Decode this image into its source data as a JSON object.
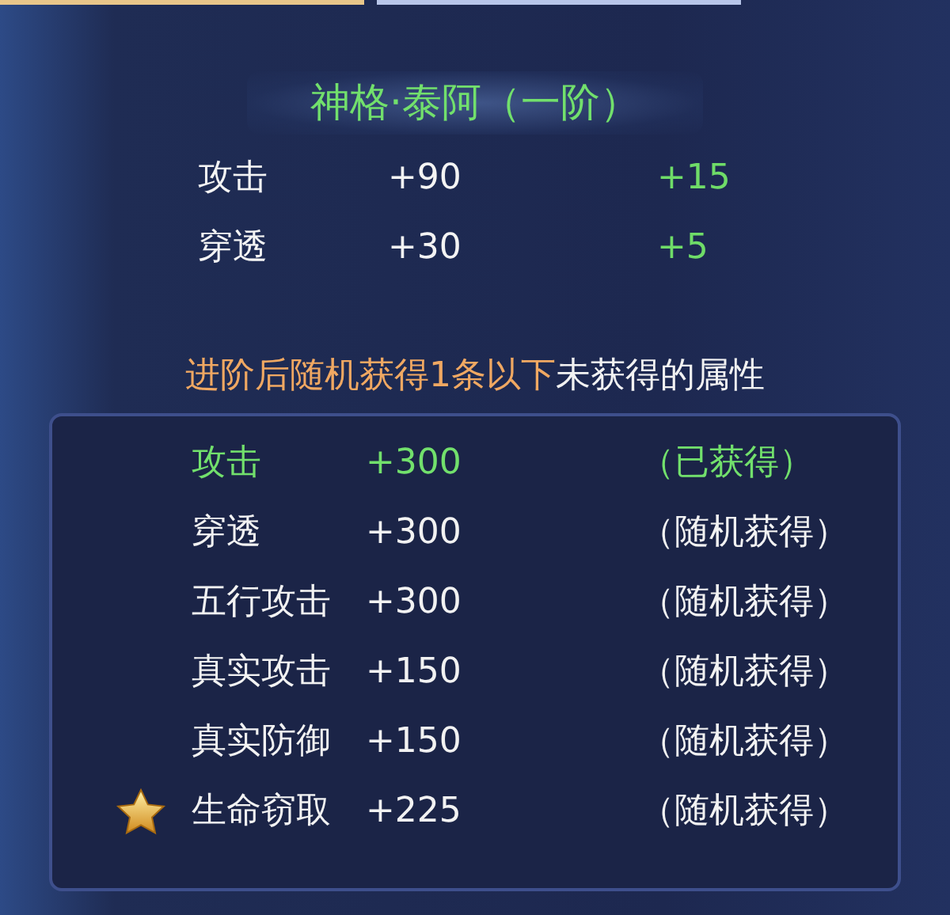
{
  "title": "神格·泰阿（一阶）",
  "stats": [
    {
      "name": "攻击",
      "value": "+90",
      "bonus": "+15"
    },
    {
      "name": "穿透",
      "value": "+30",
      "bonus": "+5"
    }
  ],
  "notice": {
    "highlight": "进阶后随机获得1条以下",
    "rest": "未获得的属性"
  },
  "attributes": [
    {
      "name": "攻击",
      "value": "+300",
      "status": "（已获得）",
      "obtained": true,
      "starred": false
    },
    {
      "name": "穿透",
      "value": "+300",
      "status": "（随机获得）",
      "obtained": false,
      "starred": false
    },
    {
      "name": "五行攻击",
      "value": "+300",
      "status": "（随机获得）",
      "obtained": false,
      "starred": false
    },
    {
      "name": "真实攻击",
      "value": "+150",
      "status": "（随机获得）",
      "obtained": false,
      "starred": false
    },
    {
      "name": "真实防御",
      "value": "+150",
      "status": "（随机获得）",
      "obtained": false,
      "starred": false
    },
    {
      "name": "生命窃取",
      "value": "+225",
      "status": "（随机获得）",
      "obtained": false,
      "starred": true
    }
  ]
}
